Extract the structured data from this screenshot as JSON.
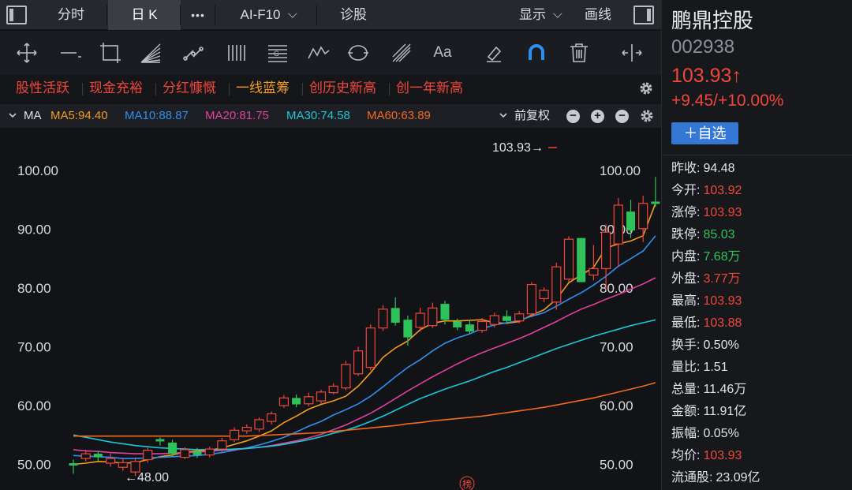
{
  "tabs": {
    "fenshi": "分时",
    "rik": "日 K",
    "more": "•••",
    "aif10": "AI-F10",
    "zhengu": "诊股",
    "xianshi": "显示",
    "huaxian": "画线"
  },
  "tools": {
    "text_tool": "Aa"
  },
  "tags": [
    "股性活跃",
    "现金充裕",
    "分红慷慨",
    "一线蓝筹",
    "创历史新高",
    "创一年新高"
  ],
  "ma_row": {
    "label": "MA",
    "ma5": "MA5:94.40",
    "ma10": "MA10:88.87",
    "ma20": "MA20:81.75",
    "ma30": "MA30:74.58",
    "ma60": "MA60:63.89",
    "restore": "前复权"
  },
  "colors": {
    "ma5": "#f39c1e",
    "ma10": "#2f8ff0",
    "ma20": "#e0409c",
    "ma30": "#1cc6d8",
    "ma60": "#f06a1e",
    "up": "#f0463a",
    "down": "#2fc25b",
    "tag_orange": "#f39c1e",
    "tag_red": "#f0463a"
  },
  "stock": {
    "name": "鹏鼎控股",
    "code": "002938",
    "price": "103.93↑",
    "change": "+9.45/+10.00%",
    "add_button": "＋自选"
  },
  "stats": [
    {
      "label": "昨收:",
      "value": "94.48",
      "color": "white"
    },
    {
      "label": "今开:",
      "value": "103.92",
      "color": "red"
    },
    {
      "label": "涨停:",
      "value": "103.93",
      "color": "red"
    },
    {
      "label": "跌停:",
      "value": "85.03",
      "color": "green"
    },
    {
      "label": "内盘:",
      "value": "7.68万",
      "color": "green"
    },
    {
      "label": "外盘:",
      "value": "3.77万",
      "color": "red"
    },
    {
      "label": "最高:",
      "value": "103.93",
      "color": "red"
    },
    {
      "label": "最低:",
      "value": "103.88",
      "color": "red"
    },
    {
      "label": "换手:",
      "value": "0.50%",
      "color": "white"
    },
    {
      "label": "量比:",
      "value": "1.51",
      "color": "white"
    },
    {
      "label": "总量:",
      "value": "11.46万",
      "color": "white"
    },
    {
      "label": "金额:",
      "value": "11.91亿",
      "color": "white"
    },
    {
      "label": "振幅:",
      "value": "0.05%",
      "color": "white"
    },
    {
      "label": "均价:",
      "value": "103.93",
      "color": "red"
    },
    {
      "label": "流通股:",
      "value": "23.09亿",
      "color": "white"
    }
  ],
  "chart_data": {
    "type": "candlestick",
    "y_ticks": [
      "100.00",
      "90.00",
      "80.00",
      "70.00",
      "60.00",
      "50.00"
    ],
    "ylim": [
      47,
      104.5
    ],
    "max_label": "103.93→",
    "min_label": "←48.00",
    "badge": "榜",
    "candles": [
      {
        "o": 50.2,
        "c": 49.8,
        "h": 50.8,
        "l": 48.4
      },
      {
        "o": 51.0,
        "c": 51.8,
        "h": 52.5,
        "l": 50.5
      },
      {
        "o": 51.8,
        "c": 51.2,
        "h": 52.3,
        "l": 50.6
      },
      {
        "o": 50.2,
        "c": 51.0,
        "h": 51.8,
        "l": 49.6
      },
      {
        "o": 49.5,
        "c": 50.3,
        "h": 51.0,
        "l": 48.9
      },
      {
        "o": 48.7,
        "c": 50.5,
        "h": 51.2,
        "l": 48.0
      },
      {
        "o": 50.8,
        "c": 52.4,
        "h": 52.8,
        "l": 50.3
      },
      {
        "o": 54.3,
        "c": 53.9,
        "h": 54.6,
        "l": 53.2
      },
      {
        "o": 53.7,
        "c": 51.8,
        "h": 54.2,
        "l": 51.3
      },
      {
        "o": 51.2,
        "c": 52.5,
        "h": 52.9,
        "l": 50.9
      },
      {
        "o": 52.2,
        "c": 51.6,
        "h": 52.8,
        "l": 51.1
      },
      {
        "o": 51.6,
        "c": 52.6,
        "h": 53.0,
        "l": 51.2
      },
      {
        "o": 52.6,
        "c": 54.0,
        "h": 54.5,
        "l": 52.1
      },
      {
        "o": 54.2,
        "c": 55.8,
        "h": 56.3,
        "l": 53.8
      },
      {
        "o": 55.7,
        "c": 56.3,
        "h": 56.8,
        "l": 55.2
      },
      {
        "o": 56.0,
        "c": 57.6,
        "h": 58.0,
        "l": 55.5
      },
      {
        "o": 57.3,
        "c": 58.6,
        "h": 59.0,
        "l": 56.8
      },
      {
        "o": 60.0,
        "c": 61.3,
        "h": 61.8,
        "l": 59.6
      },
      {
        "o": 61.3,
        "c": 60.2,
        "h": 61.9,
        "l": 59.7
      },
      {
        "o": 60.3,
        "c": 61.5,
        "h": 62.2,
        "l": 59.9
      },
      {
        "o": 60.8,
        "c": 62.3,
        "h": 62.7,
        "l": 60.3
      },
      {
        "o": 62.2,
        "c": 63.3,
        "h": 63.8,
        "l": 61.9
      },
      {
        "o": 63.0,
        "c": 67.0,
        "h": 67.6,
        "l": 62.6
      },
      {
        "o": 65.4,
        "c": 69.3,
        "h": 70.0,
        "l": 65.0
      },
      {
        "o": 66.5,
        "c": 73.2,
        "h": 73.8,
        "l": 66.0
      },
      {
        "o": 73.2,
        "c": 76.4,
        "h": 77.1,
        "l": 72.7
      },
      {
        "o": 76.6,
        "c": 74.1,
        "h": 78.4,
        "l": 73.6
      },
      {
        "o": 74.6,
        "c": 71.6,
        "h": 75.3,
        "l": 70.2
      },
      {
        "o": 73.3,
        "c": 75.7,
        "h": 76.6,
        "l": 72.6
      },
      {
        "o": 73.6,
        "c": 76.6,
        "h": 77.5,
        "l": 73.2
      },
      {
        "o": 77.3,
        "c": 74.6,
        "h": 77.8,
        "l": 73.8
      },
      {
        "o": 74.3,
        "c": 73.3,
        "h": 74.8,
        "l": 72.8
      },
      {
        "o": 73.8,
        "c": 72.6,
        "h": 74.6,
        "l": 72.2
      },
      {
        "o": 72.8,
        "c": 74.3,
        "h": 74.9,
        "l": 72.4
      },
      {
        "o": 73.8,
        "c": 75.3,
        "h": 75.8,
        "l": 73.3
      },
      {
        "o": 75.2,
        "c": 74.4,
        "h": 76.2,
        "l": 74.0
      },
      {
        "o": 74.4,
        "c": 75.6,
        "h": 76.1,
        "l": 74.0
      },
      {
        "o": 75.6,
        "c": 80.6,
        "h": 81.0,
        "l": 75.0
      },
      {
        "o": 78.2,
        "c": 79.6,
        "h": 80.1,
        "l": 77.6
      },
      {
        "o": 77.6,
        "c": 83.6,
        "h": 84.3,
        "l": 76.3
      },
      {
        "o": 81.5,
        "c": 88.3,
        "h": 88.8,
        "l": 81.0
      },
      {
        "o": 88.5,
        "c": 81.0,
        "h": 88.5,
        "l": 81.0
      },
      {
        "o": 82.2,
        "c": 83.3,
        "h": 87.3,
        "l": 81.3
      },
      {
        "o": 83.3,
        "c": 89.5,
        "h": 90.8,
        "l": 79.6
      },
      {
        "o": 87.5,
        "c": 94.1,
        "h": 95.3,
        "l": 83.6
      },
      {
        "o": 93.0,
        "c": 89.8,
        "h": 95.0,
        "l": 88.5
      },
      {
        "o": 90.1,
        "c": 94.4,
        "h": 95.7,
        "l": 87.8
      },
      {
        "o": 94.7,
        "c": 94.3,
        "h": 98.9,
        "l": 93.8
      }
    ],
    "series": [
      {
        "name": "MA5",
        "values": [
          50.0,
          50.2,
          50.5,
          50.4,
          50.2,
          50.3,
          50.8,
          51.3,
          51.6,
          52.1,
          52.3,
          52.4,
          52.8,
          53.4,
          54.0,
          54.8,
          55.7,
          57.1,
          58.2,
          59.4,
          60.2,
          60.8,
          61.6,
          63.3,
          65.6,
          68.2,
          69.8,
          71.0,
          72.9,
          74.0,
          74.4,
          74.4,
          74.5,
          74.6,
          74.1,
          74.0,
          74.3,
          75.4,
          76.3,
          78.1,
          80.9,
          82.2,
          83.5,
          86.8,
          87.5,
          88.0,
          88.9,
          94.4
        ]
      },
      {
        "name": "MA10",
        "values": [
          51.5,
          51.4,
          51.3,
          51.2,
          51.0,
          51.0,
          51.1,
          51.2,
          51.3,
          51.4,
          51.5,
          51.7,
          52.0,
          52.4,
          52.8,
          53.3,
          53.9,
          54.6,
          55.5,
          56.5,
          57.3,
          58.4,
          59.3,
          60.3,
          61.6,
          63.2,
          64.9,
          66.5,
          67.8,
          69.3,
          70.6,
          71.5,
          72.2,
          73.1,
          73.7,
          74.1,
          74.5,
          75.2,
          75.8,
          76.9,
          78.1,
          79.2,
          80.5,
          82.0,
          83.7,
          85.0,
          86.3,
          88.87
        ]
      },
      {
        "name": "MA20",
        "values": [
          52.5,
          52.3,
          52.2,
          52.0,
          51.9,
          51.8,
          51.8,
          51.8,
          51.9,
          52.0,
          52.1,
          52.2,
          52.4,
          52.5,
          52.7,
          52.9,
          53.2,
          53.6,
          54.0,
          54.5,
          55.1,
          55.9,
          56.7,
          57.7,
          58.7,
          59.9,
          61.2,
          62.5,
          63.7,
          64.9,
          66.0,
          67.1,
          68.1,
          69.0,
          69.8,
          70.6,
          71.4,
          72.3,
          73.3,
          74.3,
          75.4,
          76.4,
          77.2,
          78.1,
          78.9,
          79.8,
          80.7,
          81.75
        ]
      },
      {
        "name": "MA30",
        "values": [
          55.0,
          54.6,
          54.2,
          53.8,
          53.5,
          53.2,
          53.0,
          52.8,
          52.7,
          52.6,
          52.5,
          52.5,
          52.5,
          52.6,
          52.7,
          52.9,
          53.1,
          53.4,
          53.8,
          54.2,
          54.7,
          55.3,
          55.8,
          56.5,
          57.3,
          58.2,
          59.2,
          60.2,
          61.2,
          62.0,
          62.8,
          63.5,
          64.2,
          65.0,
          65.8,
          66.5,
          67.3,
          68.1,
          68.9,
          69.7,
          70.4,
          71.1,
          71.8,
          72.4,
          73.0,
          73.6,
          74.1,
          74.58
        ]
      },
      {
        "name": "MA60",
        "values": [
          54.8,
          54.8,
          54.8,
          54.8,
          54.8,
          54.8,
          54.8,
          54.8,
          54.8,
          54.8,
          54.8,
          54.8,
          54.8,
          54.8,
          54.8,
          54.9,
          55.0,
          55.1,
          55.2,
          55.3,
          55.4,
          55.6,
          55.8,
          56.0,
          56.2,
          56.4,
          56.6,
          56.9,
          57.1,
          57.4,
          57.6,
          57.8,
          58.0,
          58.2,
          58.5,
          58.8,
          59.1,
          59.4,
          59.7,
          60.1,
          60.5,
          60.9,
          61.3,
          61.8,
          62.3,
          62.8,
          63.3,
          63.89
        ]
      }
    ]
  }
}
